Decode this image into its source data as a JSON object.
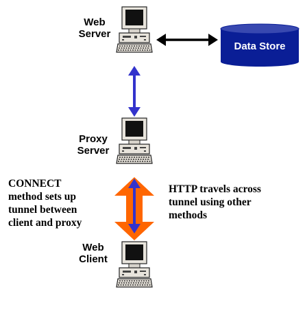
{
  "nodes": {
    "web_server": {
      "line1": "Web",
      "line2": "Server"
    },
    "proxy_server": {
      "line1": "Proxy",
      "line2": "Server"
    },
    "web_client": {
      "line1": "Web",
      "line2": "Client"
    },
    "data_store": {
      "label": "Data Store"
    }
  },
  "notes": {
    "connect": [
      "CONNECT",
      "method sets up",
      "tunnel between",
      "client and proxy"
    ],
    "http": [
      "HTTP travels across",
      "tunnel using other",
      "methods"
    ]
  },
  "colors": {
    "tunnel_orange": "#ff6600",
    "arrow_blue": "#3333cc",
    "store_blue": "#0a1e96",
    "pc_beige": "#e8e4dc",
    "monitor_screen": "#111111"
  }
}
